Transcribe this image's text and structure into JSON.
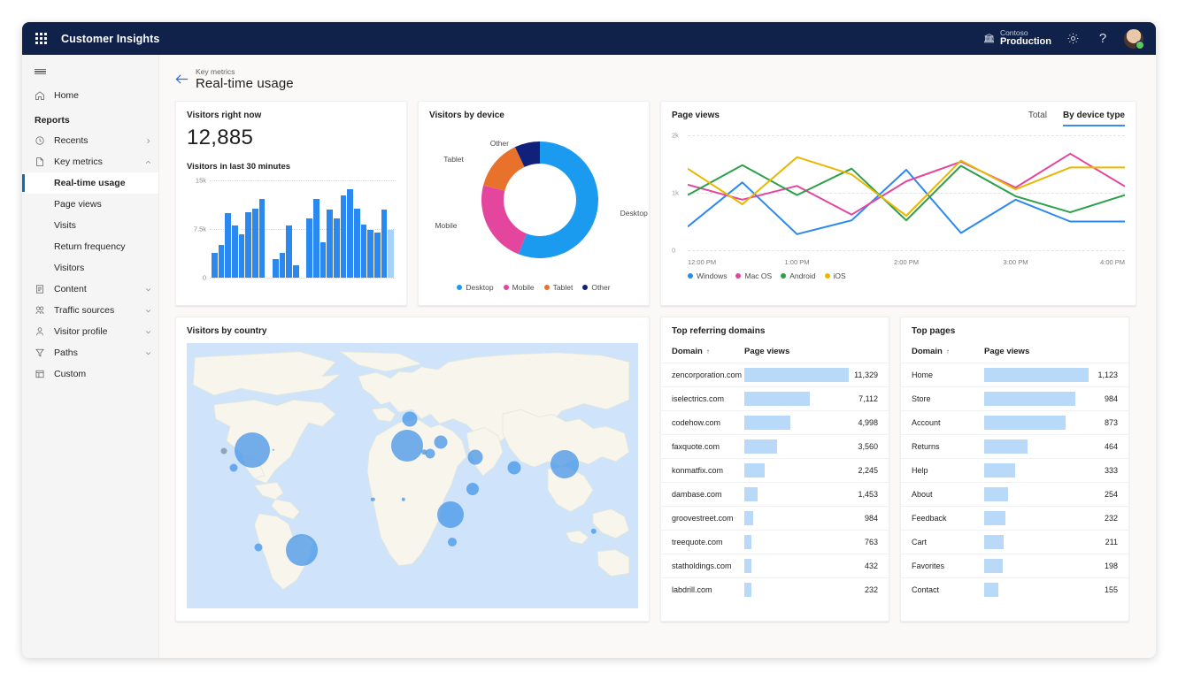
{
  "topbar": {
    "waffle_label": "app-launcher",
    "app_title": "Customer Insights",
    "org": "Contoso",
    "environment": "Production",
    "settings_icon": "gear-icon",
    "help_icon": "question-mark-icon",
    "avatar_icon": "user-avatar"
  },
  "sidebar": {
    "hamburger_label": "menu",
    "home": {
      "label": "Home",
      "icon": "home-icon"
    },
    "section_title": "Reports",
    "items": [
      {
        "label": "Recents",
        "icon": "history-icon",
        "chevron": "right"
      },
      {
        "label": "Key metrics",
        "icon": "document-icon",
        "chevron": "up"
      },
      {
        "label": "Content",
        "icon": "page-icon",
        "chevron": "down"
      },
      {
        "label": "Traffic sources",
        "icon": "traffic-icon",
        "chevron": "down"
      },
      {
        "label": "Visitor profile",
        "icon": "person-icon",
        "chevron": "down"
      },
      {
        "label": "Paths",
        "icon": "funnel-icon",
        "chevron": "down"
      },
      {
        "label": "Custom",
        "icon": "grid-icon",
        "chevron": ""
      }
    ],
    "key_metrics_children": [
      {
        "label": "Real-time usage",
        "active": true
      },
      {
        "label": "Page views",
        "active": false
      },
      {
        "label": "Visits",
        "active": false
      },
      {
        "label": "Return frequency",
        "active": false
      },
      {
        "label": "Visitors",
        "active": false
      }
    ]
  },
  "page": {
    "back_icon": "back-arrow-icon",
    "breadcrumb": "Key metrics",
    "title": "Real-time usage"
  },
  "visitors_now": {
    "title": "Visitors right now",
    "value": "12,885",
    "sub_title": "Visitors in last 30 minutes"
  },
  "devices": {
    "title": "Visitors by device"
  },
  "page_views": {
    "title": "Page views",
    "toggle": [
      {
        "label": "Total",
        "selected": false
      },
      {
        "label": "By device type",
        "selected": true
      }
    ]
  },
  "map": {
    "title": "Visitors by country"
  },
  "referrers": {
    "title": "Top referring domains",
    "columns": [
      "Domain",
      "Page views"
    ],
    "sort_indicator": "↑",
    "rows": [
      {
        "domain": "zencorporation.com",
        "views": "11,329",
        "value": 11329
      },
      {
        "domain": "iselectrics.com",
        "views": "7,112",
        "value": 7112
      },
      {
        "domain": "codehow.com",
        "views": "4,998",
        "value": 4998
      },
      {
        "domain": "faxquote.com",
        "views": "3,560",
        "value": 3560
      },
      {
        "domain": "konmatfix.com",
        "views": "2,245",
        "value": 2245
      },
      {
        "domain": "dambase.com",
        "views": "1,453",
        "value": 1453
      },
      {
        "domain": "groovestreet.com",
        "views": "984",
        "value": 984
      },
      {
        "domain": "treequote.com",
        "views": "763",
        "value": 763
      },
      {
        "domain": "statholdings.com",
        "views": "432",
        "value": 432
      },
      {
        "domain": "labdrill.com",
        "views": "232",
        "value": 232
      }
    ]
  },
  "top_pages": {
    "title": "Top pages",
    "columns": [
      "Domain",
      "Page views"
    ],
    "sort_indicator": "↑",
    "rows": [
      {
        "domain": "Home",
        "views": "1,123",
        "value": 1123
      },
      {
        "domain": "Store",
        "views": "984",
        "value": 984
      },
      {
        "domain": "Account",
        "views": "873",
        "value": 873
      },
      {
        "domain": "Returns",
        "views": "464",
        "value": 464
      },
      {
        "domain": "Help",
        "views": "333",
        "value": 333
      },
      {
        "domain": "About",
        "views": "254",
        "value": 254
      },
      {
        "domain": "Feedback",
        "views": "232",
        "value": 232
      },
      {
        "domain": "Cart",
        "views": "211",
        "value": 211
      },
      {
        "domain": "Favorites",
        "views": "198",
        "value": 198
      },
      {
        "domain": "Contact",
        "views": "155",
        "value": 155
      }
    ]
  },
  "chart_data": [
    {
      "id": "visitors_last_30_minutes",
      "type": "bar",
      "title": "Visitors in last 30 minutes",
      "ylabel": "",
      "xlabel": "",
      "ylim": [
        0,
        15000
      ],
      "ticks": [
        "0",
        "7.5k",
        "15k"
      ],
      "tick_values": [
        0,
        7500,
        15000
      ],
      "grid": true,
      "bar_color": "#2b88ef",
      "last_bar_color": "#a9d2f7",
      "values": [
        3800,
        5000,
        10000,
        8000,
        6700,
        10100,
        10600,
        12200,
        null,
        2900,
        3800,
        8100,
        1900,
        null,
        9200,
        12100,
        5500,
        10500,
        9100,
        12700,
        13700,
        10600,
        8200,
        7300,
        7000,
        10500,
        7300
      ],
      "note": "last bar rendered lighter (in-progress interval); nulls are spacing gaps"
    },
    {
      "id": "visitors_by_device",
      "type": "pie",
      "title": "Visitors by device",
      "labels": [
        "Desktop",
        "Mobile",
        "Tablet",
        "Other"
      ],
      "values": [
        56,
        23,
        14,
        7
      ],
      "colors": [
        "#1b9bf0",
        "#e4459d",
        "#e8722c",
        "#11207a"
      ],
      "legend": "bottom",
      "donut": true
    },
    {
      "id": "page_views_by_device_type",
      "type": "line",
      "title": "Page views",
      "xlabel": "",
      "ylabel": "",
      "ylim": [
        0,
        2000
      ],
      "yticks": [
        "0",
        "1k",
        "2k"
      ],
      "ytick_values": [
        0,
        1000,
        2000
      ],
      "x": [
        "12:00 PM",
        "12:30 PM",
        "1:00 PM",
        "1:30 PM",
        "2:00 PM",
        "2:30 PM",
        "3:00 PM",
        "3:30 PM",
        "4:00 PM"
      ],
      "xtick_labels": [
        "12:00 PM",
        "1:00 PM",
        "2:00 PM",
        "3:00 PM",
        "4:00 PM"
      ],
      "grid": true,
      "legend": "bottom",
      "series": [
        {
          "name": "Windows",
          "color": "#2b88ef",
          "values": [
            410,
            1180,
            280,
            520,
            1400,
            300,
            880,
            500,
            500
          ]
        },
        {
          "name": "Mac OS",
          "color": "#e4459d",
          "values": [
            1140,
            880,
            1120,
            620,
            1200,
            1540,
            1090,
            1680,
            1110
          ]
        },
        {
          "name": "Android",
          "color": "#2ca04a",
          "values": [
            960,
            1480,
            960,
            1420,
            520,
            1470,
            940,
            660,
            960
          ]
        },
        {
          "name": "iOS",
          "color": "#e8b800",
          "values": [
            1420,
            800,
            1620,
            1320,
            600,
            1560,
            1060,
            1440,
            1440
          ]
        }
      ]
    },
    {
      "id": "visitors_by_country",
      "type": "scatter",
      "title": "Visitors by country",
      "note": "world map with proportional bubbles; no numeric labels shown",
      "bubbles": [
        {
          "x": 14.5,
          "y": 40.2,
          "r": 20
        },
        {
          "x": 8.3,
          "y": 40.7,
          "r": 3.5
        },
        {
          "x": 10.4,
          "y": 47.0,
          "r": 4.5
        },
        {
          "x": 19.2,
          "y": 40.3,
          "r": 1.2
        },
        {
          "x": 49.5,
          "y": 28.8,
          "r": 8.5
        },
        {
          "x": 48.8,
          "y": 38.5,
          "r": 18
        },
        {
          "x": 54.0,
          "y": 41.5,
          "r": 5.5
        },
        {
          "x": 56.3,
          "y": 37.2,
          "r": 7.5
        },
        {
          "x": 52.6,
          "y": 41.0,
          "r": 2.8
        },
        {
          "x": 64.0,
          "y": 43.0,
          "r": 8.5
        },
        {
          "x": 72.5,
          "y": 47.0,
          "r": 7.5
        },
        {
          "x": 83.8,
          "y": 45.5,
          "r": 16
        },
        {
          "x": 63.3,
          "y": 55.0,
          "r": 7
        },
        {
          "x": 58.5,
          "y": 64.5,
          "r": 15
        },
        {
          "x": 58.8,
          "y": 75.0,
          "r": 5
        },
        {
          "x": 41.2,
          "y": 59.0,
          "r": 2.2
        },
        {
          "x": 48.0,
          "y": 59.0,
          "r": 2.2
        },
        {
          "x": 25.4,
          "y": 78.0,
          "r": 18
        },
        {
          "x": 15.9,
          "y": 77.0,
          "r": 4.5
        },
        {
          "x": 90.2,
          "y": 71.0,
          "r": 3.2
        }
      ]
    },
    {
      "id": "top_referring_domains",
      "type": "bar",
      "title": "Top referring domains",
      "categories": [
        "zencorporation.com",
        "iselectrics.com",
        "codehow.com",
        "faxquote.com",
        "konmatfix.com",
        "dambase.com",
        "groovestreet.com",
        "treequote.com",
        "statholdings.com",
        "labdrill.com"
      ],
      "values": [
        11329,
        7112,
        4998,
        3560,
        2245,
        1453,
        984,
        763,
        432,
        232
      ],
      "xlabel": "Page views",
      "bar_color": "#b8d9f8"
    },
    {
      "id": "top_pages",
      "type": "bar",
      "title": "Top pages",
      "categories": [
        "Home",
        "Store",
        "Account",
        "Returns",
        "Help",
        "About",
        "Feedback",
        "Cart",
        "Favorites",
        "Contact"
      ],
      "values": [
        1123,
        984,
        873,
        464,
        333,
        254,
        232,
        211,
        198,
        155
      ],
      "xlabel": "Page views",
      "bar_color": "#b8d9f8"
    }
  ]
}
